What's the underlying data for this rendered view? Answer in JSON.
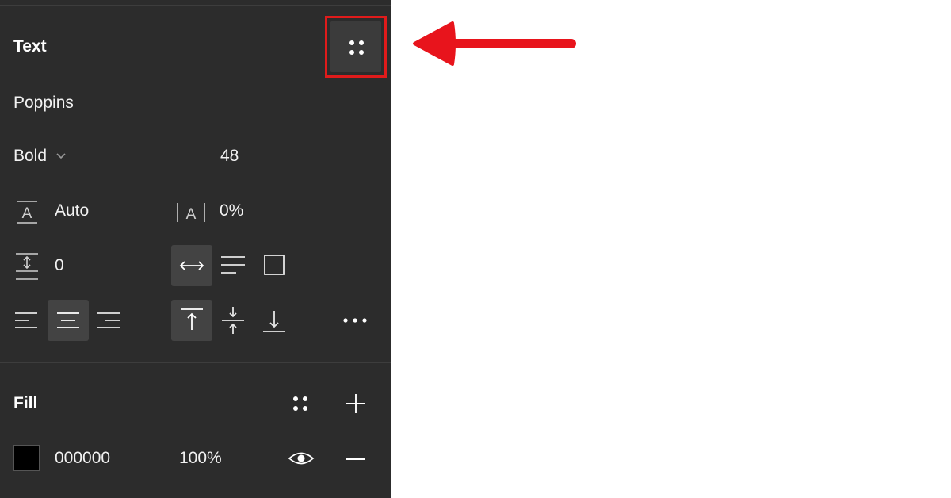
{
  "text_section": {
    "title": "Text",
    "font_family": "Poppins",
    "font_weight": "Bold",
    "font_size": "48",
    "line_height": "Auto",
    "letter_spacing": "0%",
    "paragraph_spacing": "0"
  },
  "fill_section": {
    "title": "Fill",
    "color_hex": "000000",
    "opacity": "100%",
    "swatch_color": "#000000"
  },
  "colors": {
    "panel_bg": "#2c2c2c",
    "highlight": "#e01b1b",
    "arrow": "#e8141c"
  }
}
